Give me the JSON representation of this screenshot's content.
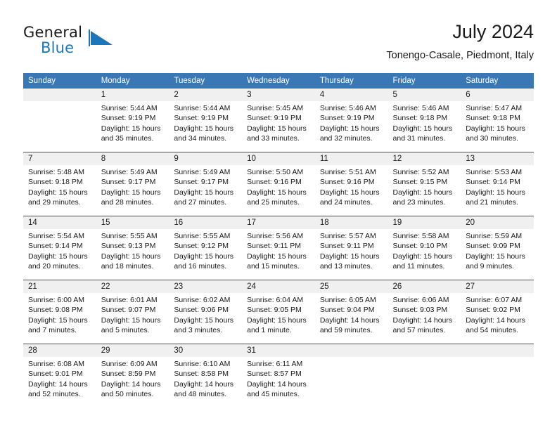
{
  "brand": {
    "name_part1": "General",
    "name_part2": "Blue",
    "logo_icon": "blue-triangle-logo"
  },
  "header": {
    "title": "July 2024",
    "subtitle": "Tonengo-Casale, Piedmont, Italy"
  },
  "colors": {
    "header_row_bg": "#3a77b5",
    "daynum_bg": "#f0f0f0",
    "brand_blue": "#1b76bc",
    "grid_line": "#4d4d4d"
  },
  "calendar": {
    "weekday_headers": [
      "Sunday",
      "Monday",
      "Tuesday",
      "Wednesday",
      "Thursday",
      "Friday",
      "Saturday"
    ],
    "weeks": [
      [
        {
          "day": "",
          "blank": true,
          "sunrise": "",
          "sunset": "",
          "daylight_line1": "",
          "daylight_line2": ""
        },
        {
          "day": "1",
          "sunrise": "Sunrise: 5:44 AM",
          "sunset": "Sunset: 9:19 PM",
          "daylight_line1": "Daylight: 15 hours",
          "daylight_line2": "and 35 minutes."
        },
        {
          "day": "2",
          "sunrise": "Sunrise: 5:44 AM",
          "sunset": "Sunset: 9:19 PM",
          "daylight_line1": "Daylight: 15 hours",
          "daylight_line2": "and 34 minutes."
        },
        {
          "day": "3",
          "sunrise": "Sunrise: 5:45 AM",
          "sunset": "Sunset: 9:19 PM",
          "daylight_line1": "Daylight: 15 hours",
          "daylight_line2": "and 33 minutes."
        },
        {
          "day": "4",
          "sunrise": "Sunrise: 5:46 AM",
          "sunset": "Sunset: 9:19 PM",
          "daylight_line1": "Daylight: 15 hours",
          "daylight_line2": "and 32 minutes."
        },
        {
          "day": "5",
          "sunrise": "Sunrise: 5:46 AM",
          "sunset": "Sunset: 9:18 PM",
          "daylight_line1": "Daylight: 15 hours",
          "daylight_line2": "and 31 minutes."
        },
        {
          "day": "6",
          "sunrise": "Sunrise: 5:47 AM",
          "sunset": "Sunset: 9:18 PM",
          "daylight_line1": "Daylight: 15 hours",
          "daylight_line2": "and 30 minutes."
        }
      ],
      [
        {
          "day": "7",
          "sunrise": "Sunrise: 5:48 AM",
          "sunset": "Sunset: 9:18 PM",
          "daylight_line1": "Daylight: 15 hours",
          "daylight_line2": "and 29 minutes."
        },
        {
          "day": "8",
          "sunrise": "Sunrise: 5:49 AM",
          "sunset": "Sunset: 9:17 PM",
          "daylight_line1": "Daylight: 15 hours",
          "daylight_line2": "and 28 minutes."
        },
        {
          "day": "9",
          "sunrise": "Sunrise: 5:49 AM",
          "sunset": "Sunset: 9:17 PM",
          "daylight_line1": "Daylight: 15 hours",
          "daylight_line2": "and 27 minutes."
        },
        {
          "day": "10",
          "sunrise": "Sunrise: 5:50 AM",
          "sunset": "Sunset: 9:16 PM",
          "daylight_line1": "Daylight: 15 hours",
          "daylight_line2": "and 25 minutes."
        },
        {
          "day": "11",
          "sunrise": "Sunrise: 5:51 AM",
          "sunset": "Sunset: 9:16 PM",
          "daylight_line1": "Daylight: 15 hours",
          "daylight_line2": "and 24 minutes."
        },
        {
          "day": "12",
          "sunrise": "Sunrise: 5:52 AM",
          "sunset": "Sunset: 9:15 PM",
          "daylight_line1": "Daylight: 15 hours",
          "daylight_line2": "and 23 minutes."
        },
        {
          "day": "13",
          "sunrise": "Sunrise: 5:53 AM",
          "sunset": "Sunset: 9:14 PM",
          "daylight_line1": "Daylight: 15 hours",
          "daylight_line2": "and 21 minutes."
        }
      ],
      [
        {
          "day": "14",
          "sunrise": "Sunrise: 5:54 AM",
          "sunset": "Sunset: 9:14 PM",
          "daylight_line1": "Daylight: 15 hours",
          "daylight_line2": "and 20 minutes."
        },
        {
          "day": "15",
          "sunrise": "Sunrise: 5:55 AM",
          "sunset": "Sunset: 9:13 PM",
          "daylight_line1": "Daylight: 15 hours",
          "daylight_line2": "and 18 minutes."
        },
        {
          "day": "16",
          "sunrise": "Sunrise: 5:55 AM",
          "sunset": "Sunset: 9:12 PM",
          "daylight_line1": "Daylight: 15 hours",
          "daylight_line2": "and 16 minutes."
        },
        {
          "day": "17",
          "sunrise": "Sunrise: 5:56 AM",
          "sunset": "Sunset: 9:11 PM",
          "daylight_line1": "Daylight: 15 hours",
          "daylight_line2": "and 15 minutes."
        },
        {
          "day": "18",
          "sunrise": "Sunrise: 5:57 AM",
          "sunset": "Sunset: 9:11 PM",
          "daylight_line1": "Daylight: 15 hours",
          "daylight_line2": "and 13 minutes."
        },
        {
          "day": "19",
          "sunrise": "Sunrise: 5:58 AM",
          "sunset": "Sunset: 9:10 PM",
          "daylight_line1": "Daylight: 15 hours",
          "daylight_line2": "and 11 minutes."
        },
        {
          "day": "20",
          "sunrise": "Sunrise: 5:59 AM",
          "sunset": "Sunset: 9:09 PM",
          "daylight_line1": "Daylight: 15 hours",
          "daylight_line2": "and 9 minutes."
        }
      ],
      [
        {
          "day": "21",
          "sunrise": "Sunrise: 6:00 AM",
          "sunset": "Sunset: 9:08 PM",
          "daylight_line1": "Daylight: 15 hours",
          "daylight_line2": "and 7 minutes."
        },
        {
          "day": "22",
          "sunrise": "Sunrise: 6:01 AM",
          "sunset": "Sunset: 9:07 PM",
          "daylight_line1": "Daylight: 15 hours",
          "daylight_line2": "and 5 minutes."
        },
        {
          "day": "23",
          "sunrise": "Sunrise: 6:02 AM",
          "sunset": "Sunset: 9:06 PM",
          "daylight_line1": "Daylight: 15 hours",
          "daylight_line2": "and 3 minutes."
        },
        {
          "day": "24",
          "sunrise": "Sunrise: 6:04 AM",
          "sunset": "Sunset: 9:05 PM",
          "daylight_line1": "Daylight: 15 hours",
          "daylight_line2": "and 1 minute."
        },
        {
          "day": "25",
          "sunrise": "Sunrise: 6:05 AM",
          "sunset": "Sunset: 9:04 PM",
          "daylight_line1": "Daylight: 14 hours",
          "daylight_line2": "and 59 minutes."
        },
        {
          "day": "26",
          "sunrise": "Sunrise: 6:06 AM",
          "sunset": "Sunset: 9:03 PM",
          "daylight_line1": "Daylight: 14 hours",
          "daylight_line2": "and 57 minutes."
        },
        {
          "day": "27",
          "sunrise": "Sunrise: 6:07 AM",
          "sunset": "Sunset: 9:02 PM",
          "daylight_line1": "Daylight: 14 hours",
          "daylight_line2": "and 54 minutes."
        }
      ],
      [
        {
          "day": "28",
          "sunrise": "Sunrise: 6:08 AM",
          "sunset": "Sunset: 9:01 PM",
          "daylight_line1": "Daylight: 14 hours",
          "daylight_line2": "and 52 minutes."
        },
        {
          "day": "29",
          "sunrise": "Sunrise: 6:09 AM",
          "sunset": "Sunset: 8:59 PM",
          "daylight_line1": "Daylight: 14 hours",
          "daylight_line2": "and 50 minutes."
        },
        {
          "day": "30",
          "sunrise": "Sunrise: 6:10 AM",
          "sunset": "Sunset: 8:58 PM",
          "daylight_line1": "Daylight: 14 hours",
          "daylight_line2": "and 48 minutes."
        },
        {
          "day": "31",
          "sunrise": "Sunrise: 6:11 AM",
          "sunset": "Sunset: 8:57 PM",
          "daylight_line1": "Daylight: 14 hours",
          "daylight_line2": "and 45 minutes."
        },
        {
          "day": "",
          "blank": true,
          "sunrise": "",
          "sunset": "",
          "daylight_line1": "",
          "daylight_line2": ""
        },
        {
          "day": "",
          "blank": true,
          "sunrise": "",
          "sunset": "",
          "daylight_line1": "",
          "daylight_line2": ""
        },
        {
          "day": "",
          "blank": true,
          "sunrise": "",
          "sunset": "",
          "daylight_line1": "",
          "daylight_line2": ""
        }
      ]
    ]
  }
}
